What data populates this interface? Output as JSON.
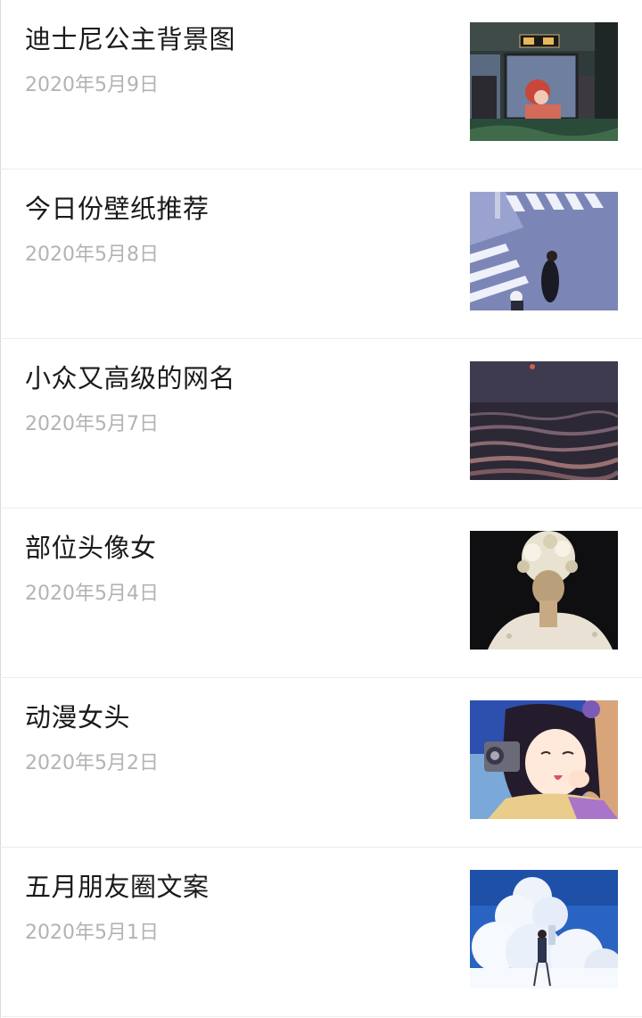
{
  "articles": [
    {
      "title": "迪士尼公主背景图",
      "date": "2020年5月9日",
      "thumbnail": "train-window-mermaid-image"
    },
    {
      "title": "今日份壁纸推荐",
      "date": "2020年5月8日",
      "thumbnail": "crosswalk-girl-image"
    },
    {
      "title": "小众又高级的网名",
      "date": "2020年5月7日",
      "thumbnail": "sunset-sea-image"
    },
    {
      "title": "部位头像女",
      "date": "2020年5月4日",
      "thumbnail": "flower-hair-back-image"
    },
    {
      "title": "动漫女头",
      "date": "2020年5月2日",
      "thumbnail": "anime-girl-camera-image"
    },
    {
      "title": "五月朋友圈文案",
      "date": "2020年5月1日",
      "thumbnail": "clouds-sky-girl-image"
    }
  ]
}
